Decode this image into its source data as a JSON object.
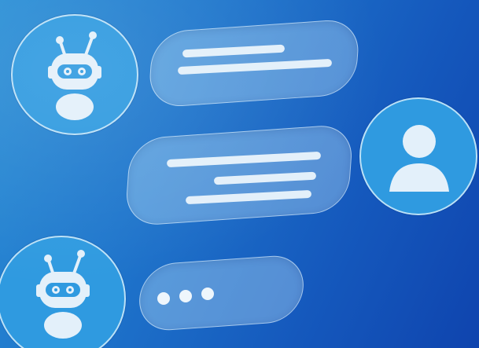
{
  "colors": {
    "background_start": "#2a8fd6",
    "background_end": "#0f44ae",
    "avatar_fill": "#2f9ae0",
    "bubble_fill": "rgba(190,225,250,0.38)",
    "glyph": "#e3f0fa"
  },
  "conversation": {
    "messages": [
      {
        "sender": "bot",
        "icon": "robot-icon",
        "content": "text-lines"
      },
      {
        "sender": "user",
        "icon": "user-icon",
        "content": "text-lines"
      },
      {
        "sender": "bot",
        "icon": "robot-icon",
        "content": "typing-dots"
      }
    ]
  }
}
